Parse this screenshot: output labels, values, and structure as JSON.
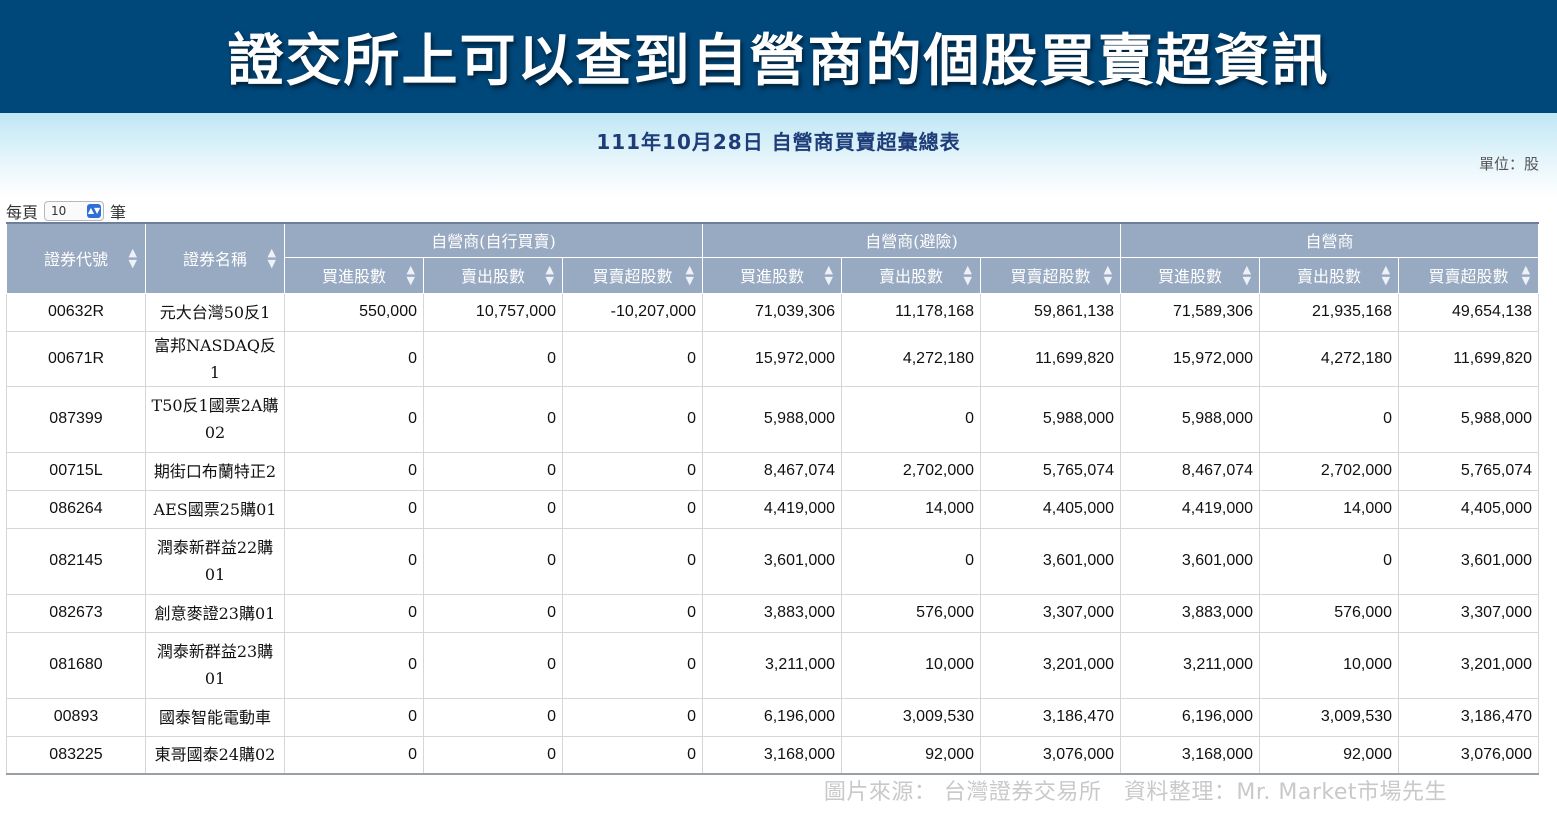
{
  "banner": {
    "title": "證交所上可以查到自營商的個股買賣超資訊"
  },
  "report": {
    "title": "111年10月28日 自營商買賣超彙總表",
    "unit": "單位：股"
  },
  "pager": {
    "prefix": "每頁",
    "value": "10",
    "suffix": "筆"
  },
  "table": {
    "header_code": "證券代號",
    "header_name": "證券名稱",
    "groups": [
      "自營商(自行買賣)",
      "自營商(避險)",
      "自營商"
    ],
    "subheaders": [
      "買進股數",
      "賣出股數",
      "買賣超股數"
    ],
    "rows": [
      {
        "code": "00632R",
        "name": "元大台灣50反1",
        "tall": false,
        "vals": [
          "550,000",
          "10,757,000",
          "-10,207,000",
          "71,039,306",
          "11,178,168",
          "59,861,138",
          "71,589,306",
          "21,935,168",
          "49,654,138"
        ]
      },
      {
        "code": "00671R",
        "name": "富邦NASDAQ反1",
        "tall": false,
        "vals": [
          "0",
          "0",
          "0",
          "15,972,000",
          "4,272,180",
          "11,699,820",
          "15,972,000",
          "4,272,180",
          "11,699,820"
        ]
      },
      {
        "code": "087399",
        "name": "T50反1國票2A購02",
        "tall": true,
        "vals": [
          "0",
          "0",
          "0",
          "5,988,000",
          "0",
          "5,988,000",
          "5,988,000",
          "0",
          "5,988,000"
        ]
      },
      {
        "code": "00715L",
        "name": "期街口布蘭特正2",
        "tall": false,
        "vals": [
          "0",
          "0",
          "0",
          "8,467,074",
          "2,702,000",
          "5,765,074",
          "8,467,074",
          "2,702,000",
          "5,765,074"
        ]
      },
      {
        "code": "086264",
        "name": "AES國票25購01",
        "tall": false,
        "vals": [
          "0",
          "0",
          "0",
          "4,419,000",
          "14,000",
          "4,405,000",
          "4,419,000",
          "14,000",
          "4,405,000"
        ]
      },
      {
        "code": "082145",
        "name": "潤泰新群益22購01",
        "tall": true,
        "vals": [
          "0",
          "0",
          "0",
          "3,601,000",
          "0",
          "3,601,000",
          "3,601,000",
          "0",
          "3,601,000"
        ]
      },
      {
        "code": "082673",
        "name": "創意麥證23購01",
        "tall": false,
        "vals": [
          "0",
          "0",
          "0",
          "3,883,000",
          "576,000",
          "3,307,000",
          "3,883,000",
          "576,000",
          "3,307,000"
        ]
      },
      {
        "code": "081680",
        "name": "潤泰新群益23購01",
        "tall": true,
        "vals": [
          "0",
          "0",
          "0",
          "3,211,000",
          "10,000",
          "3,201,000",
          "3,211,000",
          "10,000",
          "3,201,000"
        ]
      },
      {
        "code": "00893",
        "name": "國泰智能電動車",
        "tall": false,
        "vals": [
          "0",
          "0",
          "0",
          "6,196,000",
          "3,009,530",
          "3,186,470",
          "6,196,000",
          "3,009,530",
          "3,186,470"
        ]
      },
      {
        "code": "083225",
        "name": "東哥國泰24購02",
        "tall": false,
        "vals": [
          "0",
          "0",
          "0",
          "3,168,000",
          "92,000",
          "3,076,000",
          "3,168,000",
          "92,000",
          "3,076,000"
        ]
      }
    ]
  },
  "footer": {
    "text": "圖片來源： 台灣證券交易所　資料整理：Mr. Market市場先生"
  }
}
